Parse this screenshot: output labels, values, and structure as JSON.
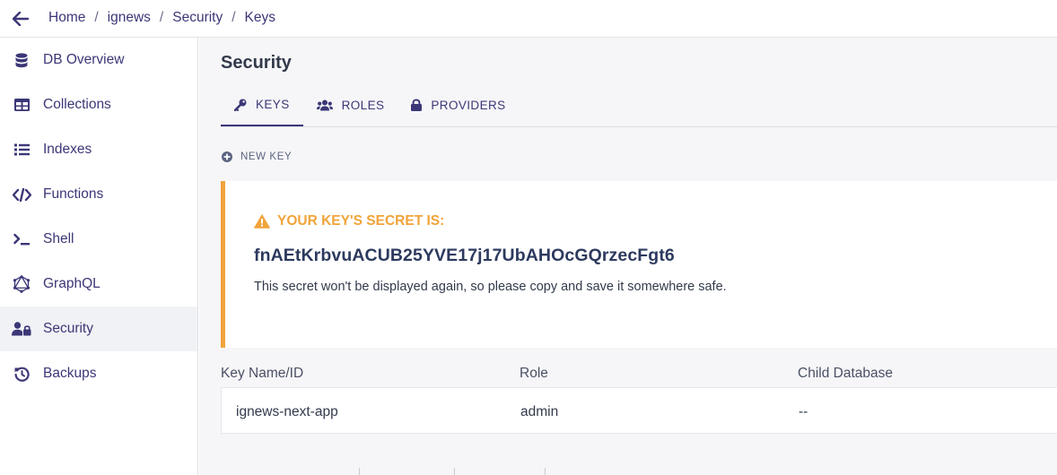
{
  "breadcrumb": [
    "Home",
    "ignews",
    "Security",
    "Keys"
  ],
  "sidebar": {
    "items": [
      {
        "label": "DB Overview",
        "icon": "database-icon"
      },
      {
        "label": "Collections",
        "icon": "table-icon"
      },
      {
        "label": "Indexes",
        "icon": "list-icon"
      },
      {
        "label": "Functions",
        "icon": "code-icon"
      },
      {
        "label": "Shell",
        "icon": "terminal-icon"
      },
      {
        "label": "GraphQL",
        "icon": "graphql-icon"
      },
      {
        "label": "Security",
        "icon": "user-lock-icon",
        "active": true
      },
      {
        "label": "Backups",
        "icon": "history-icon"
      }
    ]
  },
  "main": {
    "title": "Security",
    "tabs": [
      {
        "label": "KEYS",
        "icon": "key-icon",
        "active": true
      },
      {
        "label": "ROLES",
        "icon": "users-icon"
      },
      {
        "label": "PROVIDERS",
        "icon": "lock-icon"
      }
    ],
    "new_key_label": "NEW KEY",
    "alert": {
      "heading": "YOUR KEY'S SECRET IS:",
      "secret": "fnAEtKrbvuACUB25YVE17j17UbAHOcGQrzecFgt6",
      "note": "This secret won't be displayed again, so please copy and save it somewhere safe."
    },
    "table": {
      "columns": [
        "Key Name/ID",
        "Role",
        "Child Database"
      ],
      "rows": [
        {
          "name": "ignews-next-app",
          "role": "admin",
          "child_db": "--"
        }
      ]
    }
  },
  "colors": {
    "brand": "#3b3777",
    "warning": "#f0a43a",
    "active_bg": "#f1f2f6"
  }
}
